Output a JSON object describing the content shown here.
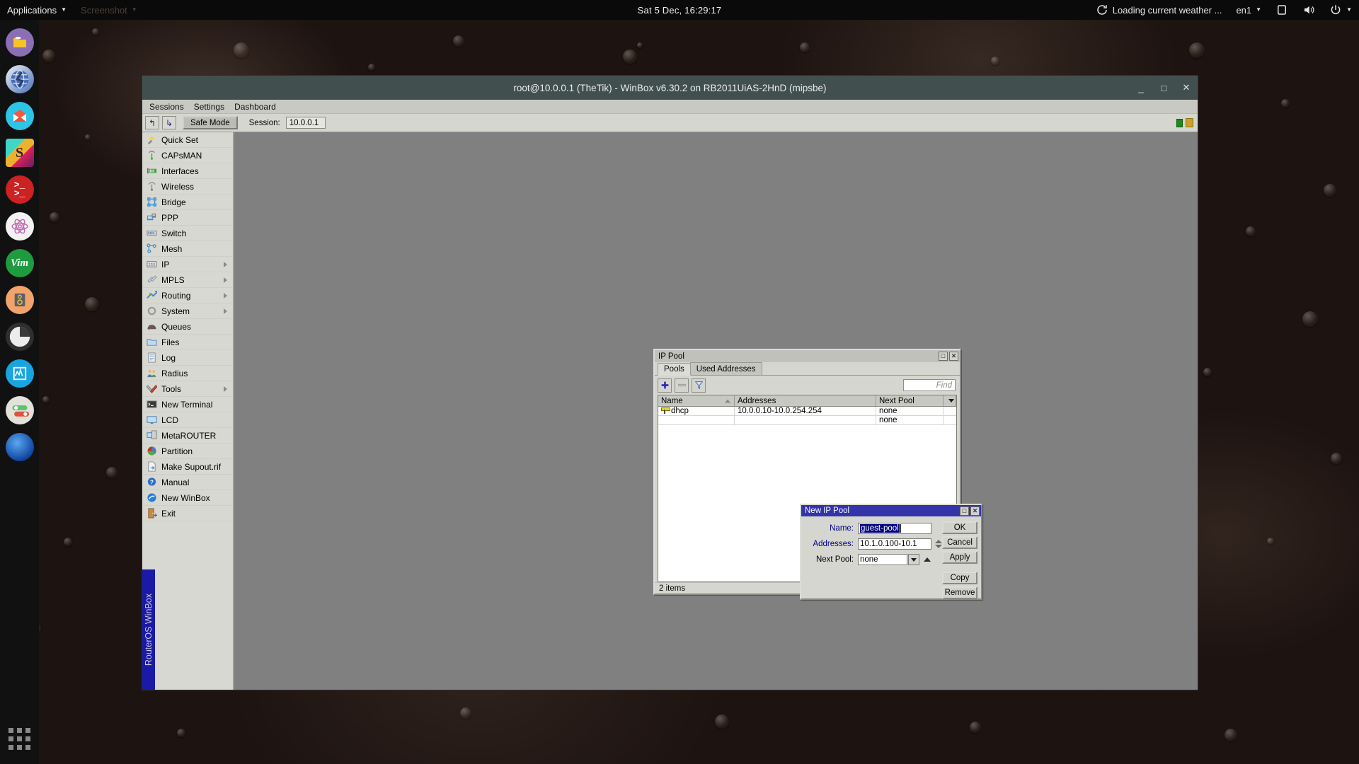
{
  "top_panel": {
    "applications_label": "Applications",
    "screenshot_label": "Screenshot",
    "clock": "Sat  5 Dec, 16:29:17",
    "weather": "Loading current weather ...",
    "keyboard_layout": "en1",
    "refresh_icon": "refresh-icon",
    "notification_icon": "notification-icon",
    "volume_icon": "volume-icon",
    "power_icon": "power-icon"
  },
  "dock": {
    "items": [
      {
        "name": "files-manager",
        "icon": "folder-icon",
        "bg": "#8a6fb5",
        "glyph": ""
      },
      {
        "name": "web-browser",
        "icon": "globe-icon",
        "bg": "#4a6fb5",
        "glyph": ""
      },
      {
        "name": "mail-client",
        "icon": "envelope-icon",
        "bg": "#2ec4e6",
        "glyph": ""
      },
      {
        "name": "slack",
        "icon": "slack-icon",
        "bg": "#ffffff",
        "glyph": "S"
      },
      {
        "name": "terminal",
        "icon": "terminal-icon",
        "bg": "#cc2222",
        "glyph": ">_"
      },
      {
        "name": "atom-editor",
        "icon": "atom-icon",
        "bg": "#f2f2f2",
        "glyph": ""
      },
      {
        "name": "vim",
        "icon": "vim-icon",
        "bg": "#1f9b3f",
        "glyph": "Vim"
      },
      {
        "name": "audio-device",
        "icon": "speaker-icon",
        "bg": "#f2a36b",
        "glyph": ""
      },
      {
        "name": "disk-utility",
        "icon": "disk-icon",
        "bg": "#eeeeee",
        "glyph": ""
      },
      {
        "name": "system-monitor",
        "icon": "graph-icon",
        "bg": "#18a4e0",
        "glyph": ""
      },
      {
        "name": "settings-toggles",
        "icon": "toggles-icon",
        "bg": "#e0e0d8",
        "glyph": ""
      },
      {
        "name": "planet-app",
        "icon": "planet-icon",
        "bg": "#1d6fd1",
        "glyph": ""
      }
    ],
    "app_grid_icon": "app-grid-icon"
  },
  "winbox": {
    "title": "root@10.0.0.1 (TheTik) - WinBox v6.30.2 on RB2011UiAS-2HnD (mipsbe)",
    "window_buttons": {
      "minimize": "_",
      "maximize": "□",
      "close": "✕"
    },
    "menus": [
      "Sessions",
      "Settings",
      "Dashboard"
    ],
    "toolbar": {
      "undo_icon": "undo-icon",
      "redo_icon": "redo-icon",
      "safe_mode_label": "Safe Mode",
      "session_label": "Session:",
      "session_value": "10.0.0.1",
      "status_green_icon": "resource-indicator-icon",
      "lock_icon": "lock-icon"
    },
    "vertical_tab_label": "RouterOS WinBox",
    "nav_items": [
      {
        "label": "Quick Set",
        "icon": "quickset-icon",
        "arrow": false
      },
      {
        "label": "CAPsMAN",
        "icon": "capsman-icon",
        "arrow": false
      },
      {
        "label": "Interfaces",
        "icon": "interfaces-icon",
        "arrow": false
      },
      {
        "label": "Wireless",
        "icon": "wireless-icon",
        "arrow": false
      },
      {
        "label": "Bridge",
        "icon": "bridge-icon",
        "arrow": false
      },
      {
        "label": "PPP",
        "icon": "ppp-icon",
        "arrow": false
      },
      {
        "label": "Switch",
        "icon": "switch-icon",
        "arrow": false
      },
      {
        "label": "Mesh",
        "icon": "mesh-icon",
        "arrow": false
      },
      {
        "label": "IP",
        "icon": "ip-icon",
        "arrow": true
      },
      {
        "label": "MPLS",
        "icon": "mpls-icon",
        "arrow": true
      },
      {
        "label": "Routing",
        "icon": "routing-icon",
        "arrow": true
      },
      {
        "label": "System",
        "icon": "system-gear-icon",
        "arrow": true
      },
      {
        "label": "Queues",
        "icon": "queues-icon",
        "arrow": false
      },
      {
        "label": "Files",
        "icon": "files-icon",
        "arrow": false
      },
      {
        "label": "Log",
        "icon": "log-icon",
        "arrow": false
      },
      {
        "label": "Radius",
        "icon": "radius-icon",
        "arrow": false
      },
      {
        "label": "Tools",
        "icon": "tools-icon",
        "arrow": true
      },
      {
        "label": "New Terminal",
        "icon": "terminal-icon",
        "arrow": false
      },
      {
        "label": "LCD",
        "icon": "lcd-icon",
        "arrow": false
      },
      {
        "label": "MetaROUTER",
        "icon": "metarouter-icon",
        "arrow": false
      },
      {
        "label": "Partition",
        "icon": "partition-icon",
        "arrow": false
      },
      {
        "label": "Make Supout.rif",
        "icon": "supout-icon",
        "arrow": false
      },
      {
        "label": "Manual",
        "icon": "manual-icon",
        "arrow": false
      },
      {
        "label": "New WinBox",
        "icon": "winbox-icon",
        "arrow": false
      },
      {
        "label": "Exit",
        "icon": "exit-icon",
        "arrow": false
      }
    ]
  },
  "ip_pool": {
    "title": "IP Pool",
    "window_buttons": {
      "maximize": "□",
      "close": "✕"
    },
    "tabs": [
      {
        "label": "Pools",
        "active": true
      },
      {
        "label": "Used Addresses",
        "active": false
      }
    ],
    "toolbar": {
      "add_icon": "plus-icon",
      "remove_icon": "minus-icon",
      "filter_icon": "filter-icon",
      "find_placeholder": "Find"
    },
    "columns": [
      "Name",
      "Addresses",
      "Next Pool"
    ],
    "rows": [
      {
        "name": "dhcp",
        "addresses": "10.0.0.10-10.0.254.254",
        "next_pool": "none",
        "icon": "pool-icon"
      },
      {
        "name": "",
        "addresses": "",
        "next_pool": "none",
        "icon": "pool-icon"
      }
    ],
    "status": "2 items"
  },
  "new_ip_pool": {
    "title": "New IP Pool",
    "window_buttons": {
      "maximize": "□",
      "close": "✕"
    },
    "fields": {
      "name_label": "Name:",
      "name_value": "guest-pool",
      "addresses_label": "Addresses:",
      "addresses_value": "10.1.0.100-10.1",
      "next_pool_label": "Next Pool:",
      "next_pool_value": "none"
    },
    "buttons": [
      "OK",
      "Cancel",
      "Apply",
      "Copy",
      "Remove"
    ]
  },
  "colors": {
    "winbox_titlebar": "#41504f",
    "dialog_titlebar_active": "#3333aa",
    "vertical_tab": "#1a1aa8",
    "panel_bg": "#0a0a0a",
    "canvas_bg": "#808080"
  }
}
